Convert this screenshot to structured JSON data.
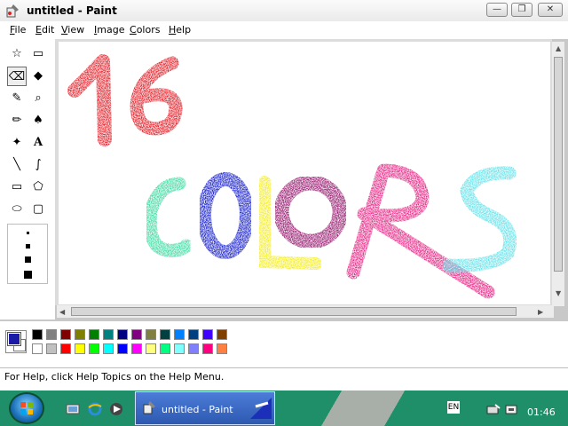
{
  "window": {
    "title": "untitled - Paint",
    "min_glyph": "—",
    "max_glyph": "❐",
    "close_glyph": "✕"
  },
  "menu": {
    "items": [
      {
        "first": "F",
        "rest": "ile"
      },
      {
        "first": "E",
        "rest": "dit"
      },
      {
        "first": "V",
        "rest": "iew"
      },
      {
        "first": "I",
        "rest": "mage"
      },
      {
        "first": "C",
        "rest": "olors"
      },
      {
        "first": "H",
        "rest": "elp"
      }
    ]
  },
  "tools": {
    "free_select": "☆",
    "rect_select": "▭",
    "eraser": "⌫",
    "fill": "◆",
    "picker": "✎",
    "magnifier": "⌕",
    "pencil": "✏",
    "brush": "♠",
    "airbrush": "✦",
    "text": "A",
    "line": "╲",
    "curve": "∫",
    "rectangle": "▭",
    "polygon": "⬠",
    "ellipse": "⬭",
    "rounded_rect": "▢"
  },
  "canvas_text": {
    "number": "16",
    "word": "COLORS"
  },
  "palette": {
    "row1": [
      "#000000",
      "#808080",
      "#800000",
      "#808000",
      "#008000",
      "#008080",
      "#000080",
      "#800080",
      "#808040",
      "#004040",
      "#0080ff",
      "#004080",
      "#4000ff",
      "#804000"
    ],
    "row2": [
      "#ffffff",
      "#c0c0c0",
      "#ff0000",
      "#ffff00",
      "#00ff00",
      "#00ffff",
      "#0000ff",
      "#ff00ff",
      "#ffff80",
      "#00ff80",
      "#80ffff",
      "#8080ff",
      "#ff0080",
      "#ff8040"
    ],
    "foreground": "#1a1aa6",
    "background": "#ffffff"
  },
  "status": {
    "text": "For Help, click Help Topics on the Help Menu."
  },
  "taskbar": {
    "task_label": "untitled - Paint",
    "language": "EN",
    "clock": "01:46"
  }
}
